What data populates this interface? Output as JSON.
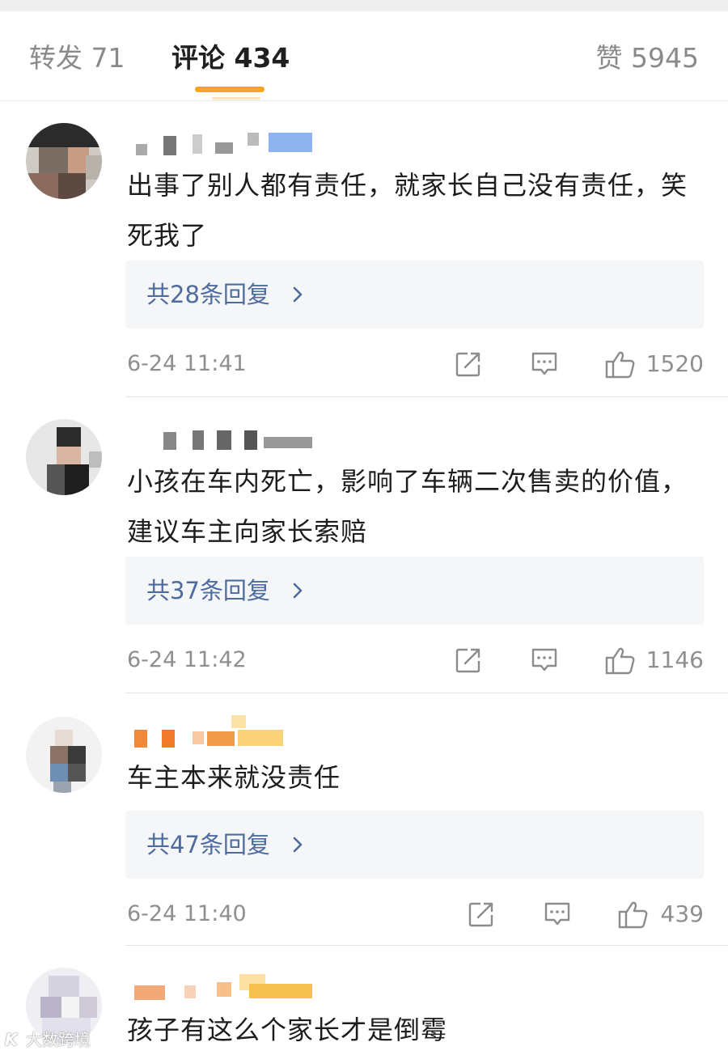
{
  "tabs": {
    "repost": "转发 71",
    "comments": "评论 434",
    "likes": "赞 5945"
  },
  "colors": {
    "accent": "#f5a623",
    "link": "#4d6b9e",
    "meta": "#8f8f8f"
  },
  "icons": [
    "share-icon",
    "comment-icon",
    "like-icon",
    "chevron-right-icon"
  ],
  "comments": [
    {
      "text": "出事了别人都有责任，就家长自己没有责任，笑死我了",
      "replies": "共28条回复",
      "time": "6-24 11:41",
      "likes": "1520"
    },
    {
      "text": "小孩在车内死亡，影响了车辆二次售卖的价值，建议车主向家长索赔",
      "replies": "共37条回复",
      "time": "6-24 11:42",
      "likes": "1146"
    },
    {
      "text": "车主本来就没责任",
      "replies": "共47条回复",
      "time": "6-24 11:40",
      "likes": "439"
    },
    {
      "text": "孩子有这么个家长才是倒霉"
    }
  ],
  "watermark": {
    "logo": "K",
    "text": "大数跨境"
  }
}
